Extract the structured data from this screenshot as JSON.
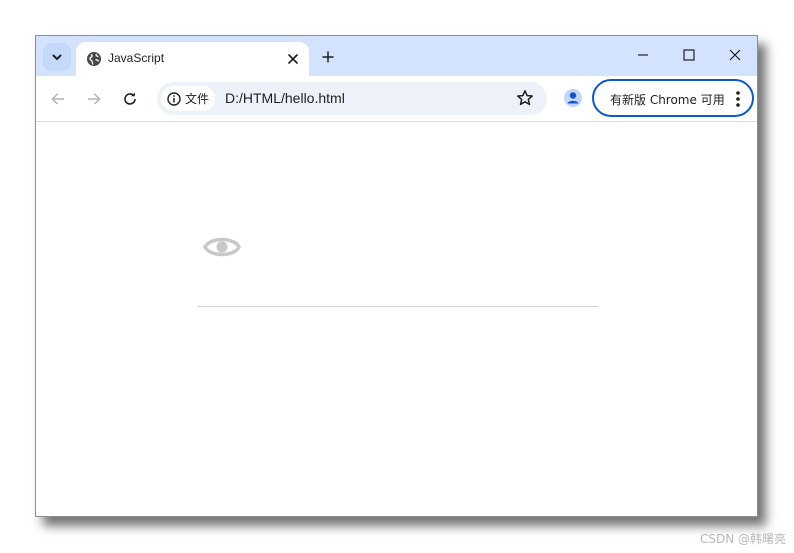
{
  "tab": {
    "title": "JavaScript",
    "favicon": "globe-icon"
  },
  "address_bar": {
    "chip_label": "文件",
    "url": "D:/HTML/hello.html"
  },
  "update_button": {
    "label": "有新版 Chrome 可用"
  },
  "watermark": "CSDN @韩曙亮",
  "colors": {
    "tabstrip_bg": "#d3e3fd",
    "omnibox_bg": "#edf2fa",
    "update_border": "#0b57d0",
    "profile_blue": "#0b57d0"
  },
  "page": {
    "icon": "eye-icon"
  }
}
